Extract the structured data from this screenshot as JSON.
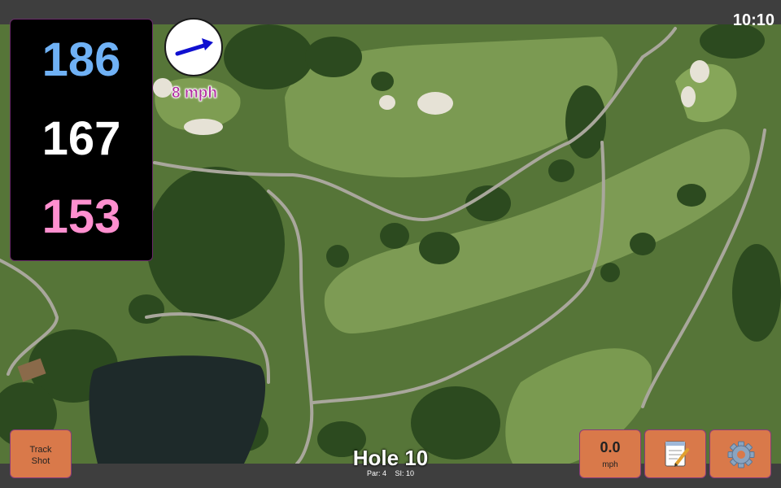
{
  "status_bar": {
    "time": "10:10"
  },
  "distances": {
    "back": "186",
    "middle": "167",
    "front": "153",
    "colors": {
      "back": "#6fb1f5",
      "middle": "#ffffff",
      "front": "#ff8fcf"
    }
  },
  "wind": {
    "speed": "8 mph",
    "direction_icon": "arrow-right-icon",
    "arrow_color": "#1010d0",
    "speed_color": "#b030a0"
  },
  "buttons": {
    "track_shot": {
      "line1": "Track",
      "line2": "Shot"
    },
    "speed": {
      "value": "0.0",
      "unit": "mph"
    },
    "notes": {
      "icon": "notepad-icon"
    },
    "settings": {
      "icon": "gear-icon"
    },
    "color": "#d9794a"
  },
  "hole": {
    "title": "Hole 10",
    "par": "Par: 4",
    "stroke_index": "SI: 10"
  },
  "map": {
    "type": "satellite-golf-course"
  }
}
